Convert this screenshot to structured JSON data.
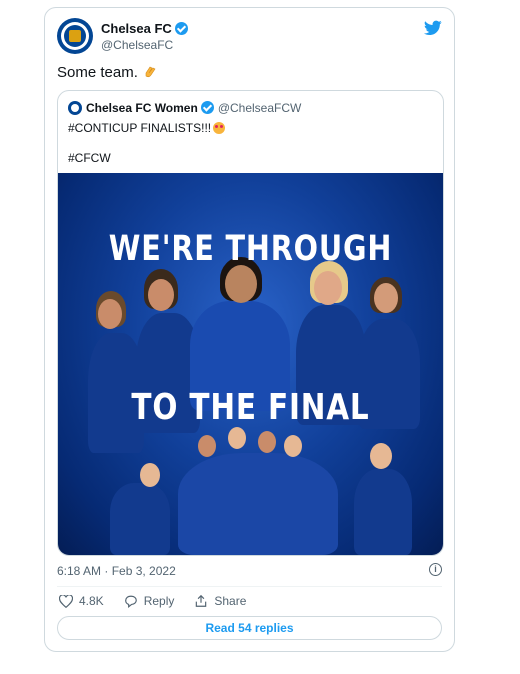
{
  "tweet": {
    "author_name": "Chelsea FC",
    "author_handle": "@ChelseaFC",
    "text": "Some team.",
    "timestamp": "6:18 AM · Feb 3, 2022",
    "likes": "4.8K",
    "reply_label": "Reply",
    "share_label": "Share",
    "read_replies_label": "Read 54 replies"
  },
  "quoted": {
    "author_name": "Chelsea FC Women",
    "author_handle": "@ChelseaFCW",
    "line1": "#CONTICUP FINALISTS!!!",
    "line2": "#CFCW",
    "poster_line1": "WE'RE THROUGH",
    "poster_line2": "TO THE FINAL"
  },
  "colors": {
    "accent": "#1d9bf0",
    "chelsea_blue": "#034694"
  },
  "icons": [
    "twitter-bird-icon",
    "verified-icon",
    "clap-icon",
    "heart-icon",
    "reply-icon",
    "share-icon",
    "info-icon",
    "star-struck-emoji-icon"
  ]
}
